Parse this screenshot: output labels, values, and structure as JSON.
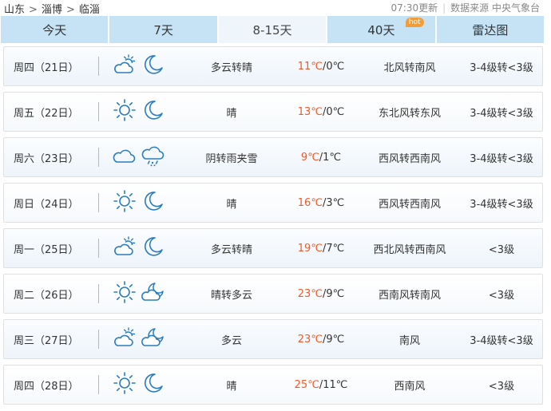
{
  "breadcrumb": [
    "山东",
    "淄博",
    "临淄"
  ],
  "update_time": "07:30更新",
  "source": "数据来源 中央气象台",
  "tabs": [
    {
      "label": "今天",
      "active": false
    },
    {
      "label": "7天",
      "active": false
    },
    {
      "label": "8-15天",
      "active": true
    },
    {
      "label": "40天",
      "active": false,
      "badge": "hot"
    },
    {
      "label": "雷达图",
      "active": false
    }
  ],
  "colors": {
    "tab_bg": "#c6e3f6",
    "high_temp": "#f05a28",
    "icon_stroke": "#2b7cc0"
  },
  "days": [
    {
      "day": "周四（21日）",
      "icons": [
        "partly-cloudy-icon",
        "moon-icon"
      ],
      "condition": "多云转晴",
      "high": "11℃",
      "low": "/0℃",
      "wind": "北风转南风",
      "level": "3-4级转<3级"
    },
    {
      "day": "周五（22日）",
      "icons": [
        "sun-icon",
        "moon-icon"
      ],
      "condition": "晴",
      "high": "13℃",
      "low": "/0℃",
      "wind": "东北风转东风",
      "level": "3-4级转<3级"
    },
    {
      "day": "周六（23日）",
      "icons": [
        "cloud-icon",
        "sleet-icon"
      ],
      "condition": "阴转雨夹雪",
      "high": "9℃",
      "low": "/1℃",
      "wind": "西风转西南风",
      "level": "3-4级转<3级"
    },
    {
      "day": "周日（24日）",
      "icons": [
        "sun-icon",
        "moon-icon"
      ],
      "condition": "晴",
      "high": "16℃",
      "low": "/3℃",
      "wind": "西风转西南风",
      "level": "3-4级转<3级"
    },
    {
      "day": "周一（25日）",
      "icons": [
        "partly-cloudy-icon",
        "moon-icon"
      ],
      "condition": "多云转晴",
      "high": "19℃",
      "low": "/7℃",
      "wind": "西北风转西南风",
      "level": "<3级"
    },
    {
      "day": "周二（26日）",
      "icons": [
        "sun-icon",
        "cloudy-night-icon"
      ],
      "condition": "晴转多云",
      "high": "23℃",
      "low": "/9℃",
      "wind": "西南风转南风",
      "level": "<3级"
    },
    {
      "day": "周三（27日）",
      "icons": [
        "partly-cloudy-icon",
        "cloudy-night-icon"
      ],
      "condition": "多云",
      "high": "23℃",
      "low": "/9℃",
      "wind": "南风",
      "level": "3-4级转<3级"
    },
    {
      "day": "周四（28日）",
      "icons": [
        "sun-icon",
        "moon-icon"
      ],
      "condition": "晴",
      "high": "25℃",
      "low": "/11℃",
      "wind": "西南风",
      "level": "<3级"
    }
  ]
}
